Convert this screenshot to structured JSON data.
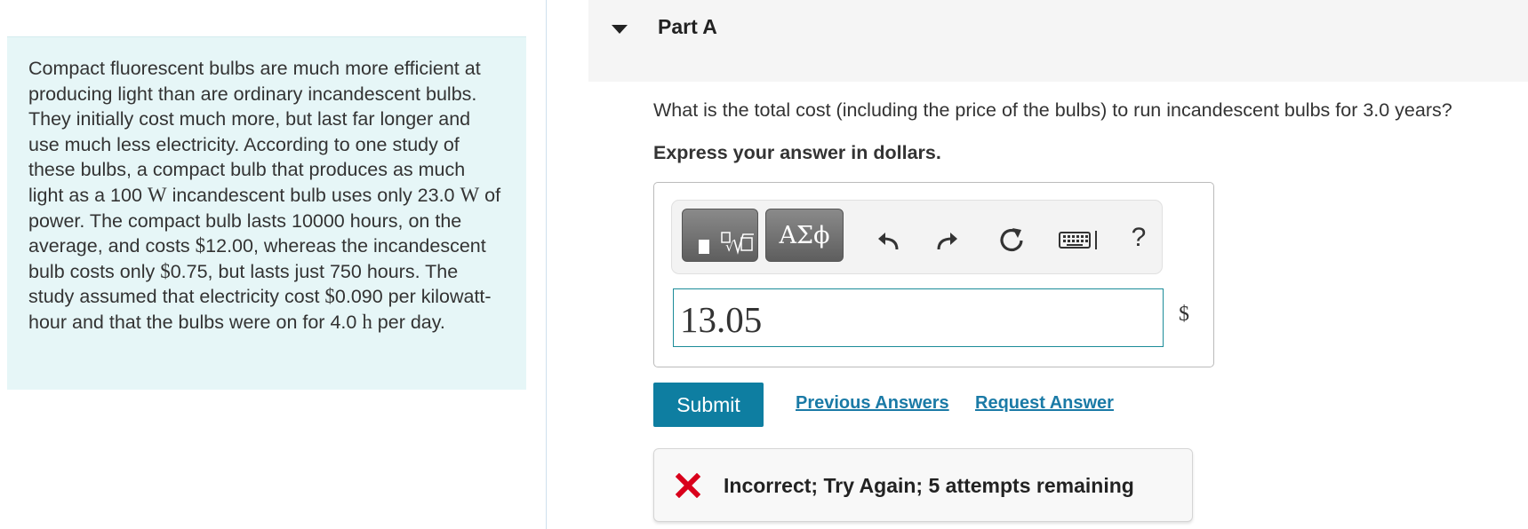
{
  "problem": {
    "p1": "Compact fluorescent bulbs are much more efficient at producing light than are ordinary incandescent bulbs. They initially cost much more, but last far longer and use much less electricity. According to one study of these bulbs, a compact bulb that produces as much light as a 100 ",
    "u1": "W",
    "p2": " incandescent bulb uses only 23.0 ",
    "u2": "W",
    "p3": " of power. The compact bulb lasts 10000 hours, on the average, and costs ",
    "u3": "$",
    "p4": "12.00, whereas the incandescent bulb costs only ",
    "u4": "$",
    "p5": "0.75, but lasts just 750 hours. The study assumed that electricity cost ",
    "u5": "$",
    "p6": "0.090 per kilowatt-hour and that the bulbs were on for 4.0 ",
    "u6": "h",
    "p7": " per day."
  },
  "part": {
    "title": "Part A"
  },
  "question": "What is the total cost (including the price of the bulbs) to run incandescent bulbs for 3.0 years?",
  "instruction": "Express your answer in dollars.",
  "toolbar": {
    "symbols_label": "ΑΣϕ",
    "help_label": "?",
    "icons": [
      "templates-icon",
      "undo-icon",
      "redo-icon",
      "reset-icon",
      "keyboard-icon",
      "help-icon"
    ]
  },
  "answer": {
    "value": "13.05",
    "unit": "$"
  },
  "actions": {
    "submit": "Submit",
    "previous_answers": "Previous Answers",
    "request_answer": "Request Answer"
  },
  "feedback": {
    "text": "Incorrect; Try Again; 5 attempts remaining",
    "color": "#d9001b"
  },
  "colors": {
    "accent": "#0e7ea1",
    "panel_bg": "#e6f6f7",
    "input_border": "#1c8c99"
  }
}
